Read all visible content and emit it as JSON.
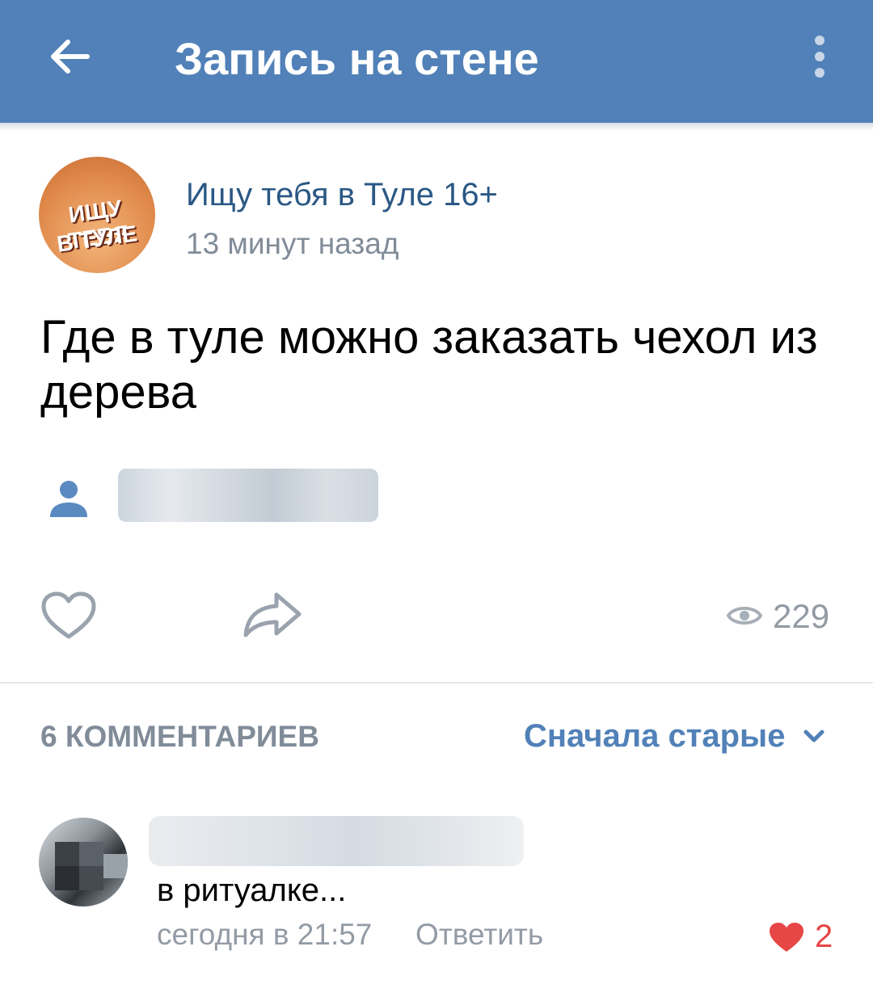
{
  "header": {
    "title": "Запись на стене",
    "back_icon": "arrow-left-icon",
    "more_icon": "more-vertical-icon"
  },
  "post": {
    "group_name": "Ищу тебя в Туле 16+",
    "time": "13 минут назад",
    "avatar_text_line1": "ИЩУ ТЕБЯ",
    "avatar_text_line2": "В ТУЛЕ",
    "text": "Где в туле можно заказать чехол из дерева",
    "views": "229"
  },
  "comments": {
    "count_label": "6 КОММЕНТАРИЕВ",
    "sort_label": "Сначала старые",
    "items": [
      {
        "text": "в ритуалке...",
        "time": "сегодня в 21:57",
        "reply_label": "Ответить",
        "likes": "2"
      }
    ]
  },
  "colors": {
    "header_bg": "#5181b8",
    "link": "#2a5885",
    "accent": "#5181b8",
    "muted": "#818c99",
    "like_red": "#e64646"
  }
}
